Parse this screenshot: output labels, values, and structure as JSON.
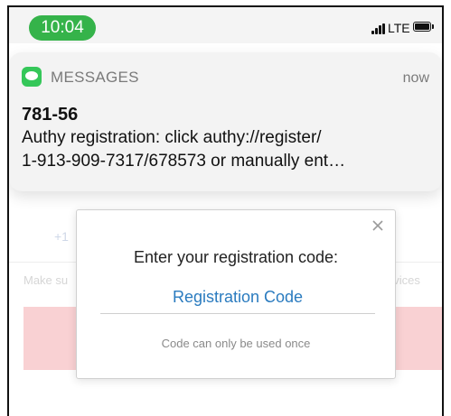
{
  "status_bar": {
    "time": "10:04",
    "carrier": "LTE",
    "time_pill_color": "#35b34a"
  },
  "background_app": {
    "phone_prefix": "+1",
    "left_text": "Make su",
    "right_text": "evices"
  },
  "notification": {
    "app_name": "MESSAGES",
    "timestamp": "now",
    "sender": "781-56",
    "body_line1": "Authy registration: click authy://register/",
    "body_line2": "1-913-909-7317/678573 or manually ent…",
    "icon": "messages-icon"
  },
  "modal": {
    "title": "Enter your registration code:",
    "input_placeholder": "Registration Code",
    "input_value": "",
    "hint": "Code can only be used once",
    "close_icon": "close-icon",
    "accent_color": "#2a7bbf"
  }
}
